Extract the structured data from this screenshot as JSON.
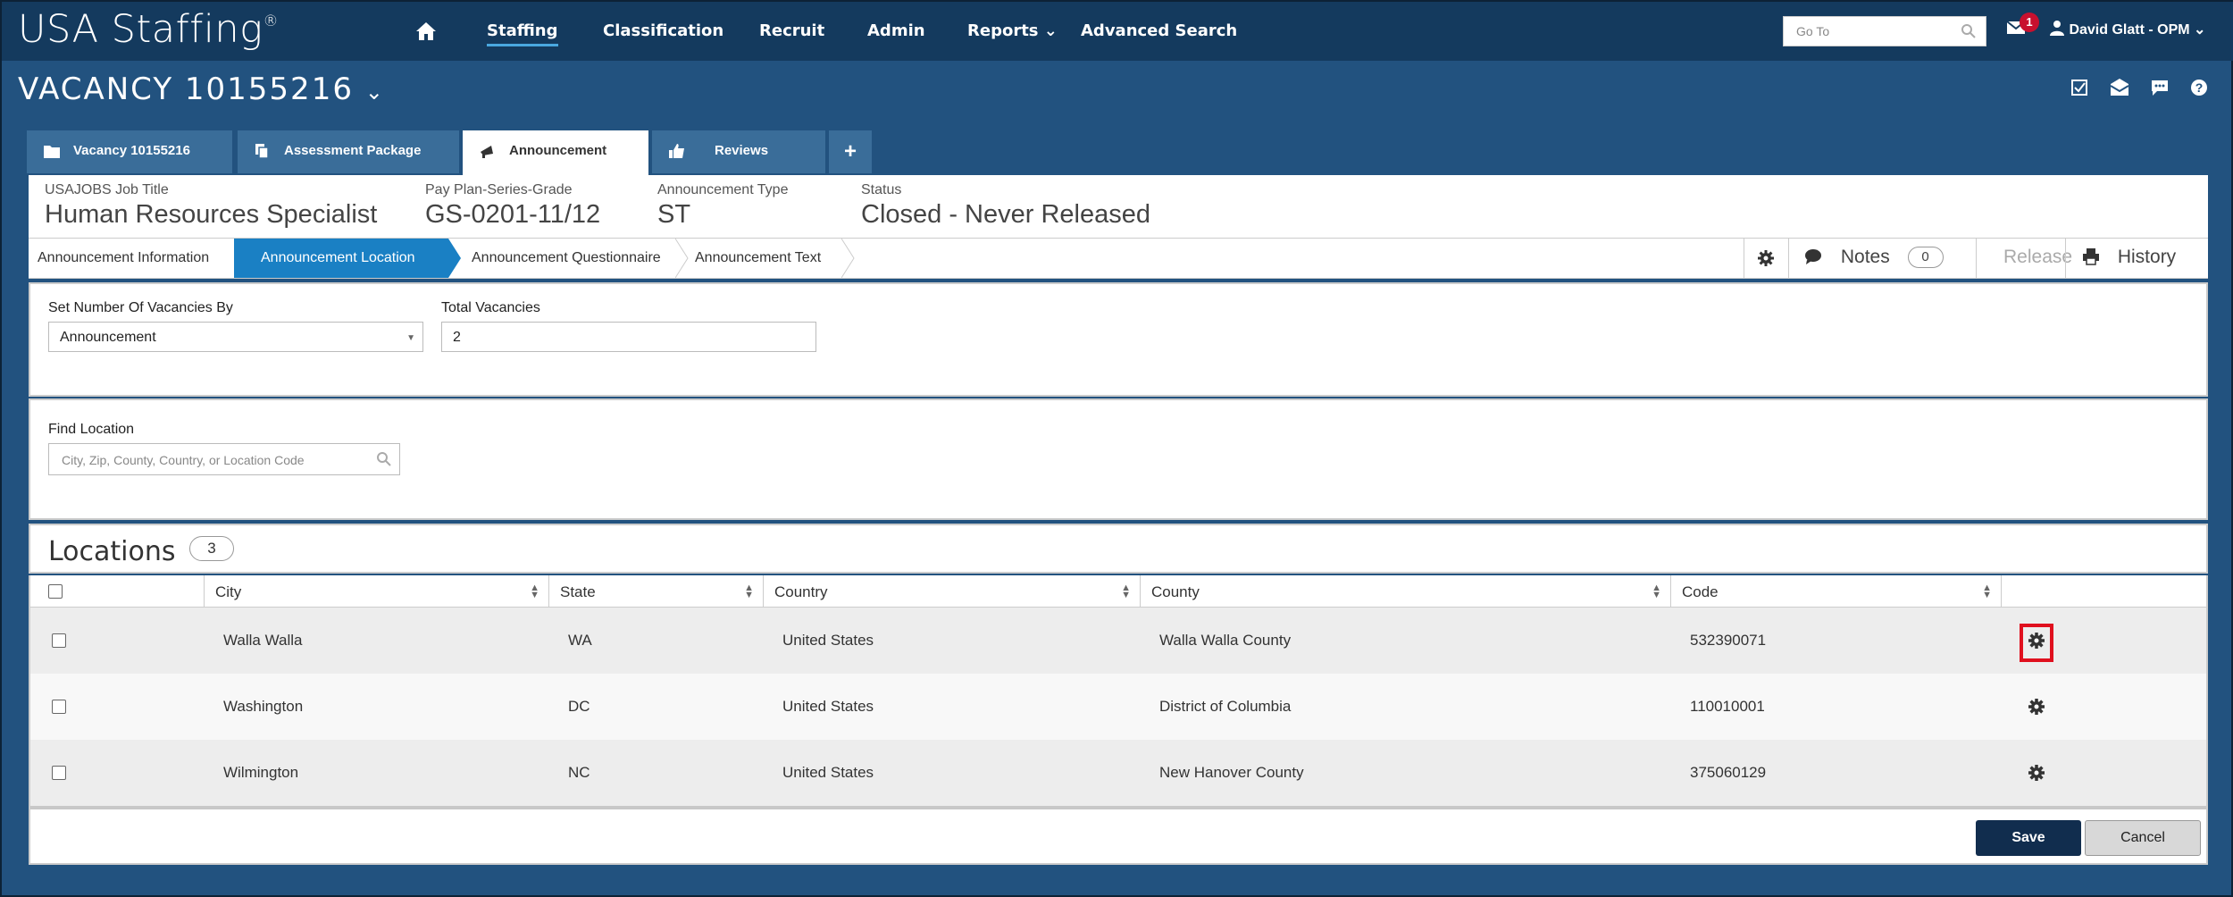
{
  "app": {
    "logo": "USA Staffing",
    "logo_mark": "®"
  },
  "nav": {
    "items": [
      "Staffing",
      "Classification",
      "Recruit",
      "Admin",
      "Reports",
      "Advanced Search"
    ],
    "goto_placeholder": "Go To",
    "notification_count": "1",
    "user": "David Glatt - OPM"
  },
  "vacancy_title": "VACANCY 10155216",
  "tabs": [
    "Vacancy 10155216",
    "Assessment Package",
    "Announcement",
    "Reviews"
  ],
  "header": {
    "job_title_label": "USAJOBS Job Title",
    "job_title": "Human Resources Specialist",
    "grade_label": "Pay Plan-Series-Grade",
    "grade": "GS-0201-11/12",
    "type_label": "Announcement Type",
    "type": "ST",
    "status_label": "Status",
    "status": "Closed - Never Released"
  },
  "steps": [
    "Announcement Information",
    "Announcement Location",
    "Announcement Questionnaire",
    "Announcement Text"
  ],
  "actions": {
    "notes": "Notes",
    "notes_count": "0",
    "release": "Release",
    "history": "History"
  },
  "vacancies": {
    "set_by_label": "Set Number Of Vacancies By",
    "set_by_value": "Announcement",
    "total_label": "Total Vacancies",
    "total_value": "2"
  },
  "find_location": {
    "label": "Find Location",
    "placeholder": "City, Zip, County, Country, or Location Code"
  },
  "locations": {
    "title": "Locations",
    "count": "3",
    "columns": [
      "City",
      "State",
      "Country",
      "County",
      "Code"
    ],
    "rows": [
      {
        "city": "Walla Walla",
        "state": "WA",
        "country": "United States",
        "county": "Walla Walla County",
        "code": "532390071"
      },
      {
        "city": "Washington",
        "state": "DC",
        "country": "United States",
        "county": "District of Columbia",
        "code": "110010001"
      },
      {
        "city": "Wilmington",
        "state": "NC",
        "country": "United States",
        "county": "New Hanover County",
        "code": "375060129"
      }
    ]
  },
  "footer": {
    "save": "Save",
    "cancel": "Cancel"
  },
  "colors": {
    "nav_bg": "#143a5e",
    "page_bg": "#22527f",
    "active_step": "#1a80c4",
    "save_btn": "#112d4e",
    "highlight": "#e0101e"
  }
}
